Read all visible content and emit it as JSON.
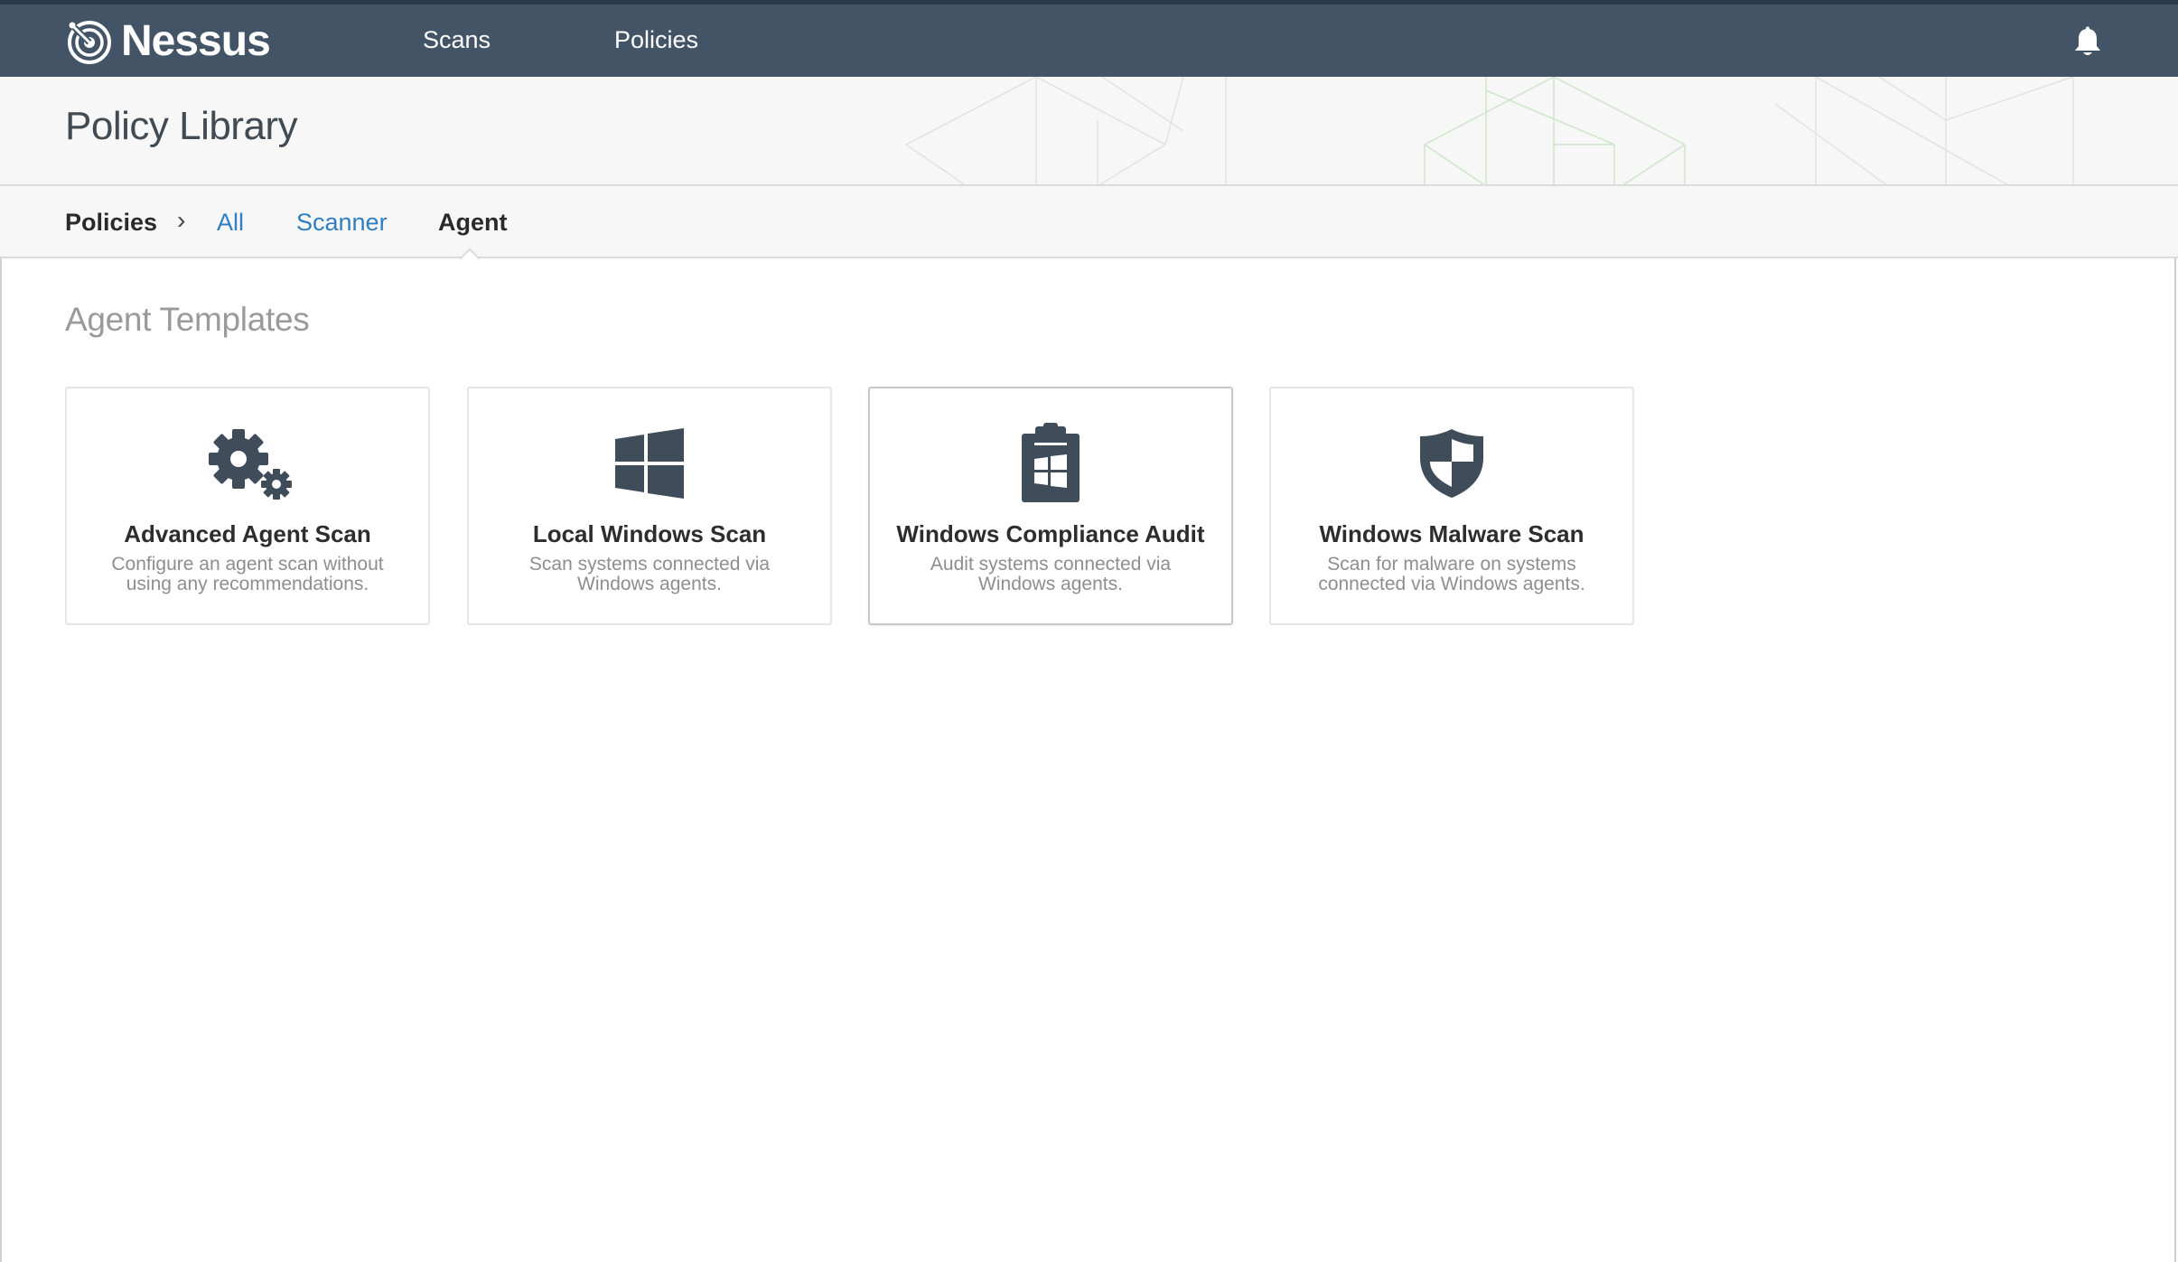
{
  "app": {
    "name": "Nessus"
  },
  "nav": {
    "scans": "Scans",
    "policies": "Policies"
  },
  "page": {
    "title": "Policy Library"
  },
  "breadcrumb": {
    "root": "Policies",
    "separator": "›",
    "tabs": [
      "All",
      "Scanner",
      "Agent"
    ],
    "active": "Agent"
  },
  "section": {
    "title": "Agent Templates"
  },
  "templates": [
    {
      "title": "Advanced Agent Scan",
      "desc_line1": "Configure an agent scan without",
      "desc_line2": "using any recommendations.",
      "icon": "gears-icon"
    },
    {
      "title": "Local Windows Scan",
      "desc_line1": "Scan systems connected via",
      "desc_line2": "Windows agents.",
      "icon": "windows-logo-icon"
    },
    {
      "title": "Windows Compliance Audit",
      "desc_line1": "Audit systems connected via",
      "desc_line2": "Windows agents.",
      "icon": "clipboard-windows-icon"
    },
    {
      "title": "Windows Malware Scan",
      "desc_line1": "Scan for malware on systems",
      "desc_line2": "connected via Windows agents.",
      "icon": "shield-icon"
    }
  ],
  "colors": {
    "topbar": "#425466",
    "link": "#2f7fc1",
    "icon": "#3f4c5a"
  }
}
